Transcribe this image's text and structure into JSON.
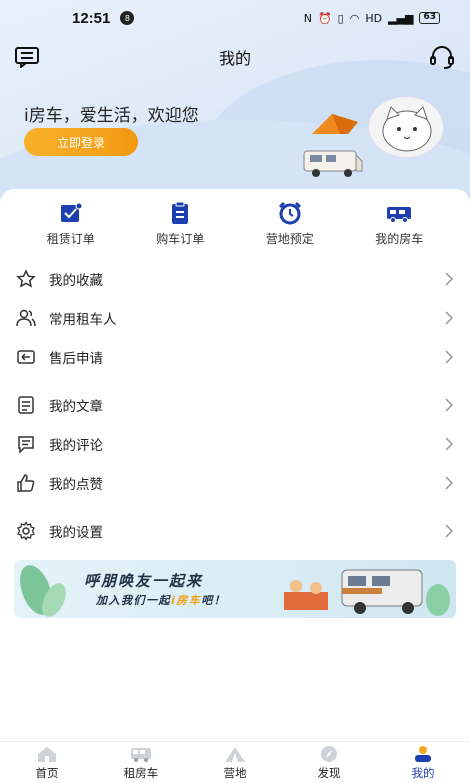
{
  "status_bar": {
    "time": "12:51",
    "notification_badge": "8",
    "network_label": "HD",
    "battery": "63"
  },
  "header": {
    "title": "我的"
  },
  "welcome": {
    "text": "i房车，爱生活，欢迎您",
    "login_label": "立即登录"
  },
  "quick_actions": [
    {
      "label": "租赁订单",
      "icon": "rental-order-icon"
    },
    {
      "label": "购车订单",
      "icon": "purchase-order-icon"
    },
    {
      "label": "营地预定",
      "icon": "alarm-clock-icon"
    },
    {
      "label": "我的房车",
      "icon": "rv-icon"
    }
  ],
  "menu": {
    "group1": [
      {
        "label": "我的收藏",
        "icon": "star-icon"
      },
      {
        "label": "常用租车人",
        "icon": "users-icon"
      },
      {
        "label": "售后申请",
        "icon": "return-icon"
      }
    ],
    "group2": [
      {
        "label": "我的文章",
        "icon": "article-icon"
      },
      {
        "label": "我的评论",
        "icon": "comment-icon"
      },
      {
        "label": "我的点赞",
        "icon": "thumbs-up-icon"
      }
    ],
    "group3": [
      {
        "label": "我的设置",
        "icon": "gear-icon"
      }
    ]
  },
  "banner": {
    "title": "呼朋唤友一起来",
    "subtitle_pre": "加入我们一起",
    "subtitle_highlight": "i房车",
    "subtitle_post": "吧！"
  },
  "tabs": [
    {
      "label": "首页",
      "icon": "home-icon"
    },
    {
      "label": "租房车",
      "icon": "bus-icon"
    },
    {
      "label": "营地",
      "icon": "tent-icon"
    },
    {
      "label": "发现",
      "icon": "compass-icon"
    },
    {
      "label": "我的",
      "icon": "profile-icon",
      "active": true
    }
  ],
  "colors": {
    "accent": "#1e3fb0",
    "button": "#f4a81f"
  }
}
